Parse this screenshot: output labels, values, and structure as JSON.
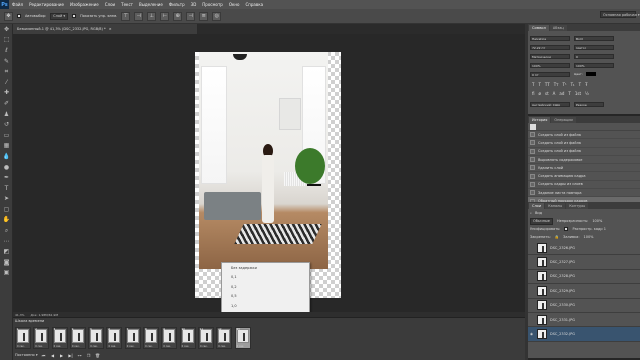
{
  "app": {
    "logo": "Ps",
    "menu": [
      "Файл",
      "Редактирование",
      "Изображение",
      "Слои",
      "Текст",
      "Выделение",
      "Фильтр",
      "3D",
      "Просмотр",
      "Окно",
      "Справка"
    ]
  },
  "options_bar": {
    "autoselect_label": "Автовыбор:",
    "autoselect_value": "Слой",
    "show_controls_label": "Показать упр. элем.",
    "workspace_value": "Основная рабочая"
  },
  "document": {
    "tab_title": "Безымянный-1 @ 41,3% (DSC_2332.JPG, RGB/8) *",
    "tab_close": "×"
  },
  "status": {
    "zoom": "41,3%",
    "doc_info": "Док: 1,98М/61,9М"
  },
  "history_dropdown": {
    "options": [
      "Без задержки",
      "0,1",
      "0,2",
      "0,5",
      "1,0",
      "2,0",
      "5,0",
      "10,0",
      "Другое...",
      "0,00 сек."
    ]
  },
  "timeline": {
    "title": "Шкала времени",
    "frames": [
      {
        "num": "1",
        "dur": "0 сек."
      },
      {
        "num": "2",
        "dur": "0 сек."
      },
      {
        "num": "3",
        "dur": "0 сек."
      },
      {
        "num": "4",
        "dur": "0 сек."
      },
      {
        "num": "5",
        "dur": "0 сек."
      },
      {
        "num": "6",
        "dur": "0 сек."
      },
      {
        "num": "7",
        "dur": "0 сек."
      },
      {
        "num": "8",
        "dur": "0 сек."
      },
      {
        "num": "9",
        "dur": "0 сек."
      },
      {
        "num": "10",
        "dur": "0 сек."
      },
      {
        "num": "11",
        "dur": "0 сек."
      },
      {
        "num": "12",
        "dur": "0 сек."
      },
      {
        "num": "13",
        "dur": "0 сек."
      }
    ],
    "loop_value": "Постоянно"
  },
  "character_panel": {
    "tabs": [
      "Символ",
      "Абзац"
    ],
    "font_family": "Helvetica",
    "font_style": "Bold",
    "font_size": "72,22 пт",
    "leading": "(Авто)",
    "kerning": "Метрически",
    "tracking": "0",
    "scale_v": "100%",
    "scale_h": "100%",
    "baseline": "0 пт",
    "color_label": "Цвет:",
    "language": "Английский: США",
    "antialias": "Резкое",
    "glyphs_row1": [
      "T",
      "T",
      "TT",
      "Tт",
      "T¹",
      "T₁",
      "T",
      "Ŧ"
    ],
    "glyphs_row2": [
      "fi",
      "ø",
      "st",
      "A",
      "ad",
      "T",
      "1st",
      "½"
    ]
  },
  "history_panel": {
    "tabs": [
      "История",
      "Операции"
    ],
    "items": [
      "Создать слой из файла",
      "Создать слой из файла",
      "Создать слой из файла",
      "Выровнять содержимое",
      "Удалить слой",
      "Создать анимацию кадра",
      "Создать кадры из слоев",
      "Задание листа повтора",
      "Обратный порядок кадров"
    ]
  },
  "layers_panel": {
    "tabs": [
      "Слои",
      "Каналы",
      "Контуры"
    ],
    "kind_label": "Вид",
    "blend_mode": "Обычные",
    "opacity_label": "Непрозрачность:",
    "opacity": "100%",
    "unify_label": "Унифицировать:",
    "propagate_label": "Распростр. кадр 1",
    "lock_label": "Закрепить:",
    "fill_label": "Заливка:",
    "fill": "100%",
    "layers": [
      {
        "name": "DSC_2326.JPG"
      },
      {
        "name": "DSC_2327.JPG"
      },
      {
        "name": "DSC_2328.JPG"
      },
      {
        "name": "DSC_2329.JPG"
      },
      {
        "name": "DSC_2330.JPG"
      },
      {
        "name": "DSC_2331.JPG"
      },
      {
        "name": "DSC_2332.JPG"
      }
    ]
  }
}
